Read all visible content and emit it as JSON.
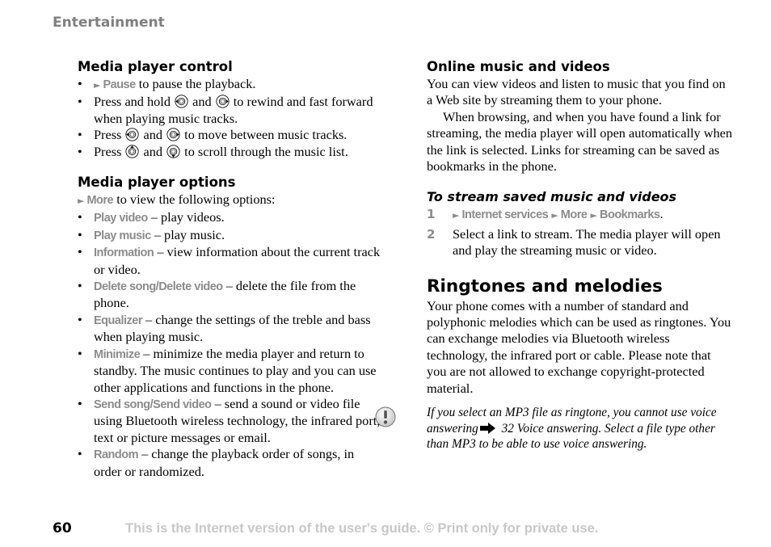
{
  "header": {
    "section": "Entertainment"
  },
  "left": {
    "control": {
      "title": "Media player control",
      "items": [
        {
          "menu": "Pause",
          "text": " to pause the playback."
        },
        {
          "pre": "Press and hold ",
          "key1": "left-key",
          "mid": " and ",
          "key2": "right-key",
          "post": " to rewind and fast forward when playing music tracks."
        },
        {
          "pre": "Press ",
          "key1": "left-key",
          "mid": " and ",
          "key2": "right-key",
          "post": " to move between music tracks."
        },
        {
          "pre": "Press ",
          "key1": "up-key",
          "mid": " and ",
          "key2": "down-key",
          "post": " to scroll through the music list."
        }
      ]
    },
    "options": {
      "title": "Media player options",
      "intro_menu": "More",
      "intro_text": " to view the following options:",
      "items": [
        {
          "menu": "Play video",
          "text": " – play videos."
        },
        {
          "menu": "Play music",
          "text": " – play music."
        },
        {
          "menu": "Information",
          "text": " – view information about the current track or video."
        },
        {
          "menu": "Delete song/Delete video",
          "text": " – delete the file from the phone."
        },
        {
          "menu": "Equalizer",
          "text": " – change the settings of the treble and bass when playing music."
        },
        {
          "menu": "Minimize",
          "text": " – minimize the media player and return to standby. The music continues to play and you can use other applications and functions in the phone."
        },
        {
          "menu": "Send song/Send video",
          "text": " – send a sound or video file using Bluetooth wireless technology, the infrared port, text or picture messages or email."
        },
        {
          "menu": "Random",
          "text": " – change the playback order of songs, in order or randomized."
        }
      ]
    }
  },
  "right": {
    "online": {
      "title": "Online music and videos",
      "para1": "You can view videos and listen to music that you find on a Web site by streaming them to your phone.",
      "para2": "When browsing, and when you have found a link for streaming, the media player will open automatically when the link is selected. Links for streaming can be saved as bookmarks in the phone."
    },
    "task": {
      "title": "To stream saved music and videos",
      "steps": [
        {
          "num": "1",
          "path": [
            "Internet services",
            "More",
            "Bookmarks"
          ],
          "end": "."
        },
        {
          "num": "2",
          "text": "Select a link to stream. The media player will open and play the streaming music or video."
        }
      ]
    },
    "ringtones": {
      "title": "Ringtones and melodies",
      "para": "Your phone comes with a number of standard and polyphonic melodies which can be used as ringtones. You can exchange melodies via Bluetooth wireless technology, the infrared port or cable. Please note that you are not allowed to exchange copyright-protected material.",
      "note_pre": "If you select an MP3 file as ringtone, you cannot use voice answering",
      "note_ref": " 32 Voice answering",
      "note_post": ". Select a file type other than MP3 to be able to use voice answering."
    }
  },
  "footer": {
    "page_number": "60",
    "notice": "This is the Internet version of the user's guide. © Print only for private use."
  }
}
